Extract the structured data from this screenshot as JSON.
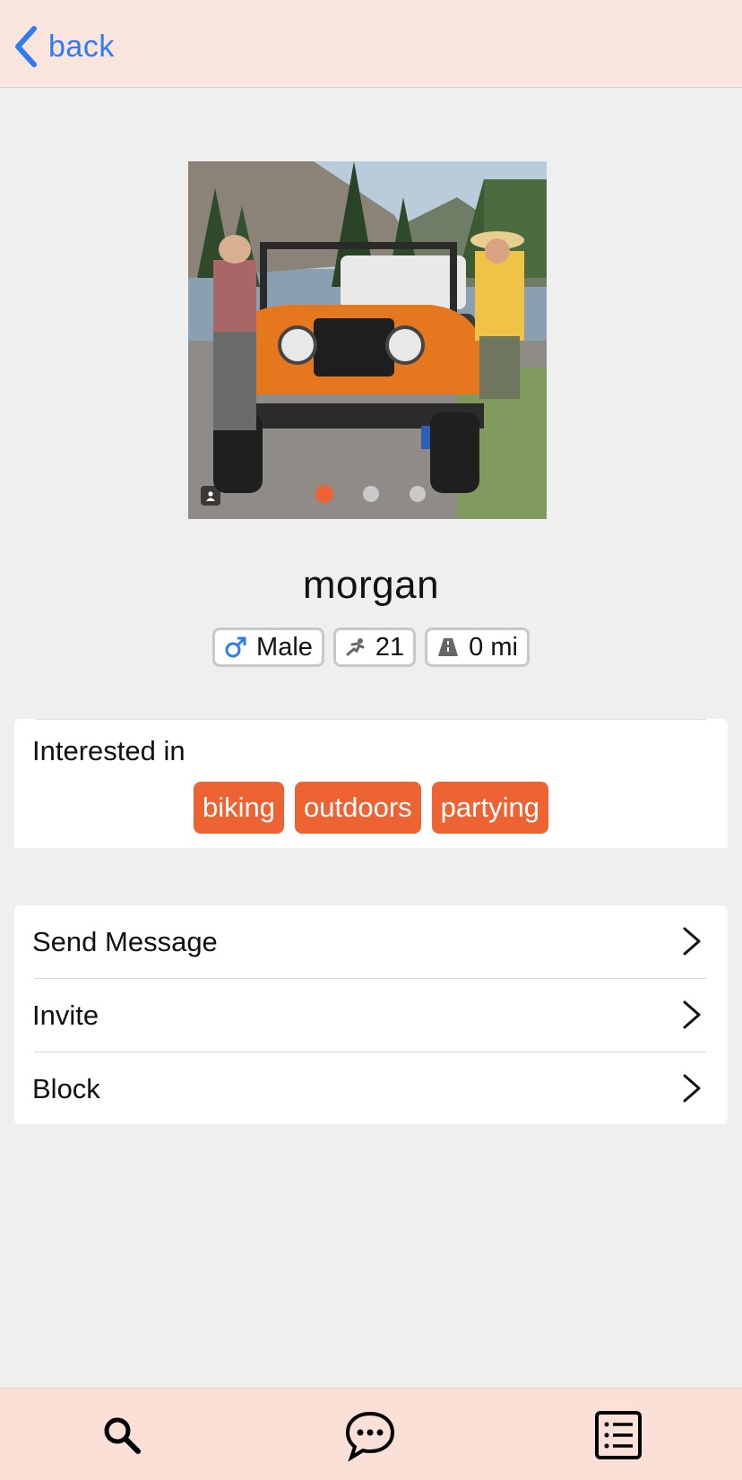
{
  "header": {
    "back_label": "back"
  },
  "profile": {
    "name": "morgan",
    "photo_count": 3,
    "active_photo": 1,
    "chips": {
      "gender": {
        "icon": "male-icon",
        "label": "Male"
      },
      "age": {
        "icon": "runner-icon",
        "label": "21"
      },
      "distance": {
        "icon": "road-icon",
        "label": "0 mi"
      }
    }
  },
  "interests": {
    "title": "Interested in",
    "tags": [
      "biking",
      "outdoors",
      "partying"
    ]
  },
  "menu": {
    "send_message": "Send Message",
    "invite": "Invite",
    "block": "Block"
  },
  "tabbar": {
    "items": [
      "search-icon",
      "chat-bubble-icon",
      "list-icon"
    ]
  },
  "colors": {
    "accent": "#ee6333",
    "link": "#2f7bf0",
    "bar_background": "#fae5de"
  }
}
